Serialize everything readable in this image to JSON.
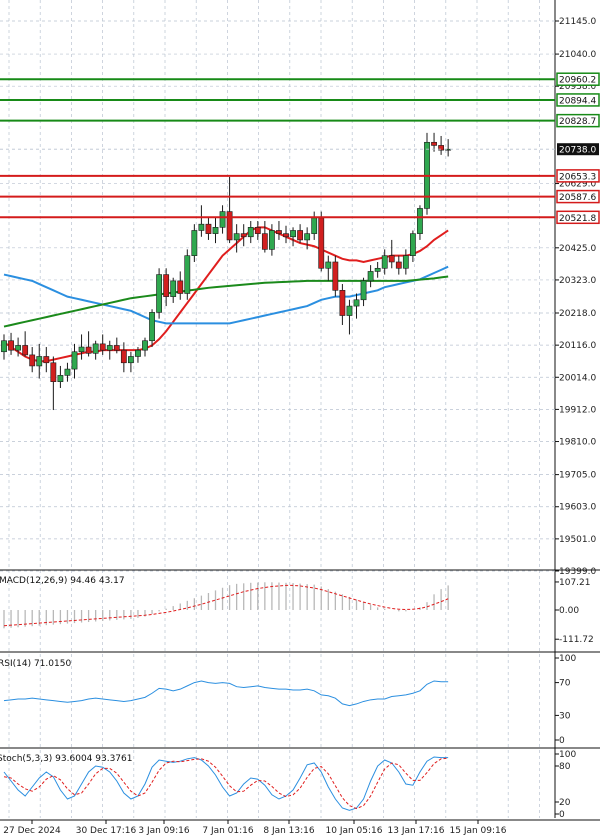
{
  "colors": {
    "background": "#ffffff",
    "grid": "#b9c2d0",
    "bull_body": "#2fa84f",
    "bear_body": "#d11f1f",
    "wick": "#1a1a1a",
    "ma_fast": "#e01e1e",
    "ma_mid": "#2b8fe0",
    "ma_slow": "#1b8a1b",
    "resistance": "#178a17",
    "support": "#d41b1b",
    "current_price_bg": "#111111",
    "macd_hist": "#b8b8b8",
    "macd_signal": "#e01e1e",
    "rsi_line": "#2b8fe0",
    "stoch_k": "#2b8fe0",
    "stoch_d": "#e01e1e"
  },
  "chart_data": {
    "type": "candlestick",
    "instrument_timeframe": "",
    "x_labels": [
      "27 Dec 2024",
      "30 Dec 17:16",
      "3 Jan 09:16",
      "7 Jan 01:16",
      "8 Jan 13:16",
      "10 Jan 05:16",
      "13 Jan 17:16",
      "15 Jan 09:16"
    ],
    "price_axis": {
      "ylim": [
        19399.0,
        21145.0
      ],
      "ticks": [
        "21145.0",
        "21040.0",
        "20938.0",
        "20629.0",
        "20425.0",
        "20323.0",
        "20218.0",
        "20116.0",
        "20014.0",
        "19912.0",
        "19810.0",
        "19705.0",
        "19603.0",
        "19501.0",
        "19399.0"
      ],
      "grid": true
    },
    "levels": [
      {
        "label": "20960.2",
        "value": 20960.2,
        "kind": "resistance"
      },
      {
        "label": "20894.4",
        "value": 20894.4,
        "kind": "resistance"
      },
      {
        "label": "20828.7",
        "value": 20828.7,
        "kind": "resistance"
      },
      {
        "label": "20738.0",
        "value": 20738.0,
        "kind": "current"
      },
      {
        "label": "20653.3",
        "value": 20653.3,
        "kind": "support"
      },
      {
        "label": "20587.6",
        "value": 20587.6,
        "kind": "support"
      },
      {
        "label": "20521.8",
        "value": 20521.8,
        "kind": "support"
      }
    ],
    "candles": [
      {
        "o": 20095,
        "h": 20150,
        "l": 20070,
        "c": 20130
      },
      {
        "o": 20130,
        "h": 20155,
        "l": 20085,
        "c": 20100
      },
      {
        "o": 20100,
        "h": 20140,
        "l": 20080,
        "c": 20115
      },
      {
        "o": 20115,
        "h": 20160,
        "l": 20080,
        "c": 20085
      },
      {
        "o": 20085,
        "h": 20110,
        "l": 20030,
        "c": 20050
      },
      {
        "o": 20050,
        "h": 20120,
        "l": 20010,
        "c": 20080
      },
      {
        "o": 20080,
        "h": 20110,
        "l": 20030,
        "c": 20060
      },
      {
        "o": 20060,
        "h": 20080,
        "l": 19910,
        "c": 20000
      },
      {
        "o": 20000,
        "h": 20050,
        "l": 19980,
        "c": 20020
      },
      {
        "o": 20020,
        "h": 20060,
        "l": 20000,
        "c": 20040
      },
      {
        "o": 20040,
        "h": 20120,
        "l": 20010,
        "c": 20095
      },
      {
        "o": 20095,
        "h": 20150,
        "l": 20070,
        "c": 20110
      },
      {
        "o": 20110,
        "h": 20160,
        "l": 20080,
        "c": 20090
      },
      {
        "o": 20090,
        "h": 20130,
        "l": 20070,
        "c": 20120
      },
      {
        "o": 20120,
        "h": 20150,
        "l": 20085,
        "c": 20100
      },
      {
        "o": 20100,
        "h": 20130,
        "l": 20070,
        "c": 20115
      },
      {
        "o": 20115,
        "h": 20140,
        "l": 20090,
        "c": 20100
      },
      {
        "o": 20100,
        "h": 20125,
        "l": 20030,
        "c": 20060
      },
      {
        "o": 20060,
        "h": 20095,
        "l": 20030,
        "c": 20080
      },
      {
        "o": 20080,
        "h": 20110,
        "l": 20060,
        "c": 20100
      },
      {
        "o": 20100,
        "h": 20140,
        "l": 20080,
        "c": 20130
      },
      {
        "o": 20130,
        "h": 20230,
        "l": 20110,
        "c": 20220
      },
      {
        "o": 20220,
        "h": 20360,
        "l": 20200,
        "c": 20340
      },
      {
        "o": 20340,
        "h": 20360,
        "l": 20240,
        "c": 20270
      },
      {
        "o": 20270,
        "h": 20330,
        "l": 20250,
        "c": 20320
      },
      {
        "o": 20320,
        "h": 20350,
        "l": 20260,
        "c": 20280
      },
      {
        "o": 20280,
        "h": 20420,
        "l": 20260,
        "c": 20400
      },
      {
        "o": 20400,
        "h": 20500,
        "l": 20380,
        "c": 20480
      },
      {
        "o": 20480,
        "h": 20560,
        "l": 20460,
        "c": 20500
      },
      {
        "o": 20500,
        "h": 20520,
        "l": 20450,
        "c": 20470
      },
      {
        "o": 20470,
        "h": 20520,
        "l": 20440,
        "c": 20490
      },
      {
        "o": 20490,
        "h": 20560,
        "l": 20470,
        "c": 20540
      },
      {
        "o": 20540,
        "h": 20650,
        "l": 20440,
        "c": 20450
      },
      {
        "o": 20450,
        "h": 20500,
        "l": 20410,
        "c": 20470
      },
      {
        "o": 20470,
        "h": 20500,
        "l": 20430,
        "c": 20460
      },
      {
        "o": 20460,
        "h": 20510,
        "l": 20440,
        "c": 20490
      },
      {
        "o": 20490,
        "h": 20510,
        "l": 20450,
        "c": 20470
      },
      {
        "o": 20470,
        "h": 20510,
        "l": 20410,
        "c": 20420
      },
      {
        "o": 20420,
        "h": 20500,
        "l": 20400,
        "c": 20480
      },
      {
        "o": 20480,
        "h": 20510,
        "l": 20450,
        "c": 20470
      },
      {
        "o": 20470,
        "h": 20495,
        "l": 20440,
        "c": 20460
      },
      {
        "o": 20460,
        "h": 20490,
        "l": 20430,
        "c": 20480
      },
      {
        "o": 20480,
        "h": 20500,
        "l": 20440,
        "c": 20450
      },
      {
        "o": 20450,
        "h": 20490,
        "l": 20420,
        "c": 20470
      },
      {
        "o": 20470,
        "h": 20540,
        "l": 20450,
        "c": 20520
      },
      {
        "o": 20520,
        "h": 20540,
        "l": 20350,
        "c": 20360
      },
      {
        "o": 20360,
        "h": 20400,
        "l": 20320,
        "c": 20380
      },
      {
        "o": 20380,
        "h": 20400,
        "l": 20270,
        "c": 20290
      },
      {
        "o": 20290,
        "h": 20310,
        "l": 20180,
        "c": 20210
      },
      {
        "o": 20210,
        "h": 20260,
        "l": 20150,
        "c": 20240
      },
      {
        "o": 20240,
        "h": 20280,
        "l": 20200,
        "c": 20260
      },
      {
        "o": 20260,
        "h": 20330,
        "l": 20240,
        "c": 20320
      },
      {
        "o": 20320,
        "h": 20370,
        "l": 20300,
        "c": 20350
      },
      {
        "o": 20350,
        "h": 20380,
        "l": 20330,
        "c": 20360
      },
      {
        "o": 20360,
        "h": 20420,
        "l": 20340,
        "c": 20400
      },
      {
        "o": 20400,
        "h": 20450,
        "l": 20360,
        "c": 20380
      },
      {
        "o": 20380,
        "h": 20400,
        "l": 20340,
        "c": 20360
      },
      {
        "o": 20360,
        "h": 20420,
        "l": 20340,
        "c": 20400
      },
      {
        "o": 20400,
        "h": 20480,
        "l": 20380,
        "c": 20470
      },
      {
        "o": 20470,
        "h": 20560,
        "l": 20450,
        "c": 20550
      },
      {
        "o": 20550,
        "h": 20790,
        "l": 20530,
        "c": 20760
      },
      {
        "o": 20760,
        "h": 20790,
        "l": 20730,
        "c": 20750
      },
      {
        "o": 20750,
        "h": 20780,
        "l": 20720,
        "c": 20735
      },
      {
        "o": 20735,
        "h": 20770,
        "l": 20715,
        "c": 20738
      }
    ],
    "moving_averages": [
      {
        "color_key": "ma_fast",
        "values": [
          20125,
          20110,
          20095,
          20080,
          20070,
          20065,
          20065,
          20070,
          20075,
          20080,
          20085,
          20090,
          20095,
          20095,
          20100,
          20100,
          20100,
          20100,
          20100,
          20100,
          20105,
          20115,
          20135,
          20160,
          20190,
          20220,
          20250,
          20280,
          20310,
          20340,
          20370,
          20400,
          20420,
          20440,
          20460,
          20480,
          20490,
          20490,
          20480,
          20470,
          20460,
          20450,
          20440,
          20435,
          20430,
          20420,
          20410,
          20400,
          20390,
          20385,
          20385,
          20380,
          20385,
          20390,
          20395,
          20400,
          20400,
          20400,
          20405,
          20415,
          20430,
          20450,
          20465,
          20480
        ]
      },
      {
        "color_key": "ma_mid",
        "values": [
          20340,
          20335,
          20330,
          20325,
          20320,
          20310,
          20300,
          20290,
          20280,
          20270,
          20265,
          20260,
          20255,
          20250,
          20245,
          20240,
          20235,
          20230,
          20225,
          20215,
          20205,
          20195,
          20190,
          20185,
          20185,
          20185,
          20185,
          20185,
          20185,
          20185,
          20185,
          20185,
          20185,
          20190,
          20195,
          20200,
          20205,
          20210,
          20215,
          20220,
          20225,
          20230,
          20235,
          20240,
          20250,
          20260,
          20265,
          20270,
          20270,
          20270,
          20275,
          20280,
          20285,
          20290,
          20300,
          20305,
          20310,
          20315,
          20320,
          20325,
          20335,
          20345,
          20355,
          20365
        ]
      },
      {
        "color_key": "ma_slow",
        "values": [
          20175,
          20180,
          20185,
          20190,
          20195,
          20200,
          20205,
          20210,
          20215,
          20220,
          20225,
          20230,
          20235,
          20240,
          20245,
          20250,
          20255,
          20260,
          20265,
          20268,
          20271,
          20274,
          20277,
          20280,
          20283,
          20286,
          20289,
          20292,
          20295,
          20298,
          20300,
          20302,
          20304,
          20306,
          20308,
          20310,
          20312,
          20314,
          20315,
          20316,
          20317,
          20318,
          20319,
          20320,
          20320,
          20320,
          20320,
          20320,
          20320,
          20320,
          20320,
          20320,
          20320,
          20320,
          20320,
          20320,
          20320,
          20320,
          20322,
          20324,
          20326,
          20328,
          20331,
          20334
        ]
      }
    ],
    "indicators": {
      "macd": {
        "label": "MACD(12,26,9) 94.46 43.17",
        "ticks": [
          "107.21",
          "0.00",
          "-111.72"
        ],
        "ylim": [
          -130,
          130
        ],
        "hist": [
          -70,
          -68,
          -66,
          -64,
          -62,
          -60,
          -58,
          -56,
          -54,
          -52,
          -50,
          -48,
          -46,
          -44,
          -42,
          -40,
          -38,
          -36,
          -34,
          -30,
          -25,
          -15,
          -5,
          5,
          15,
          25,
          35,
          45,
          55,
          65,
          75,
          85,
          95,
          100,
          102,
          104,
          105,
          106,
          106,
          105,
          104,
          103,
          101,
          99,
          97,
          90,
          80,
          70,
          60,
          50,
          40,
          30,
          20,
          10,
          5,
          0,
          -5,
          -5,
          0,
          10,
          30,
          60,
          80,
          94
        ],
        "signal": [
          -60,
          -58,
          -56,
          -54,
          -52,
          -50,
          -48,
          -46,
          -44,
          -42,
          -40,
          -38,
          -36,
          -34,
          -32,
          -30,
          -28,
          -26,
          -24,
          -22,
          -20,
          -17,
          -13,
          -9,
          -4,
          2,
          8,
          15,
          22,
          30,
          38,
          46,
          54,
          62,
          70,
          76,
          82,
          86,
          90,
          92,
          94,
          94,
          92,
          88,
          84,
          78,
          70,
          62,
          54,
          46,
          38,
          30,
          23,
          17,
          11,
          6,
          3,
          2,
          3,
          6,
          12,
          22,
          32,
          43
        ]
      },
      "rsi": {
        "label": "RSI(14) 71.0150",
        "ticks": [
          "100",
          "70",
          "30",
          "0"
        ],
        "ylim": [
          0,
          100
        ],
        "values": [
          48,
          49,
          50,
          50,
          51,
          50,
          49,
          48,
          47,
          46,
          47,
          48,
          50,
          51,
          50,
          49,
          48,
          47,
          48,
          50,
          52,
          57,
          63,
          62,
          60,
          62,
          66,
          70,
          72,
          70,
          69,
          70,
          69,
          65,
          64,
          65,
          66,
          64,
          63,
          62,
          62,
          61,
          61,
          62,
          60,
          55,
          54,
          51,
          44,
          42,
          44,
          47,
          49,
          50,
          50,
          53,
          54,
          55,
          57,
          60,
          68,
          72,
          71,
          71
        ]
      },
      "stoch": {
        "label": "Stoch(5,3,3) 93.6004 93.3761",
        "ticks": [
          "100",
          "80",
          "20",
          "0"
        ],
        "ylim": [
          0,
          100
        ],
        "k": [
          70,
          55,
          40,
          30,
          45,
          60,
          70,
          62,
          40,
          25,
          30,
          50,
          70,
          80,
          78,
          70,
          55,
          35,
          25,
          30,
          50,
          78,
          90,
          88,
          86,
          88,
          92,
          94,
          90,
          80,
          65,
          45,
          30,
          35,
          50,
          60,
          58,
          48,
          32,
          25,
          30,
          40,
          60,
          82,
          85,
          70,
          45,
          25,
          10,
          6,
          10,
          25,
          55,
          80,
          90,
          85,
          70,
          50,
          48,
          70,
          88,
          95,
          94,
          94
        ],
        "d": [
          62,
          60,
          50,
          42,
          38,
          45,
          58,
          64,
          57,
          42,
          32,
          35,
          50,
          67,
          76,
          76,
          68,
          53,
          38,
          30,
          35,
          53,
          73,
          85,
          88,
          87,
          89,
          91,
          92,
          88,
          78,
          63,
          47,
          37,
          38,
          48,
          56,
          55,
          46,
          35,
          29,
          32,
          43,
          61,
          76,
          79,
          67,
          47,
          27,
          14,
          9,
          14,
          30,
          53,
          75,
          85,
          82,
          68,
          56,
          56,
          69,
          84,
          92,
          93
        ]
      }
    }
  }
}
